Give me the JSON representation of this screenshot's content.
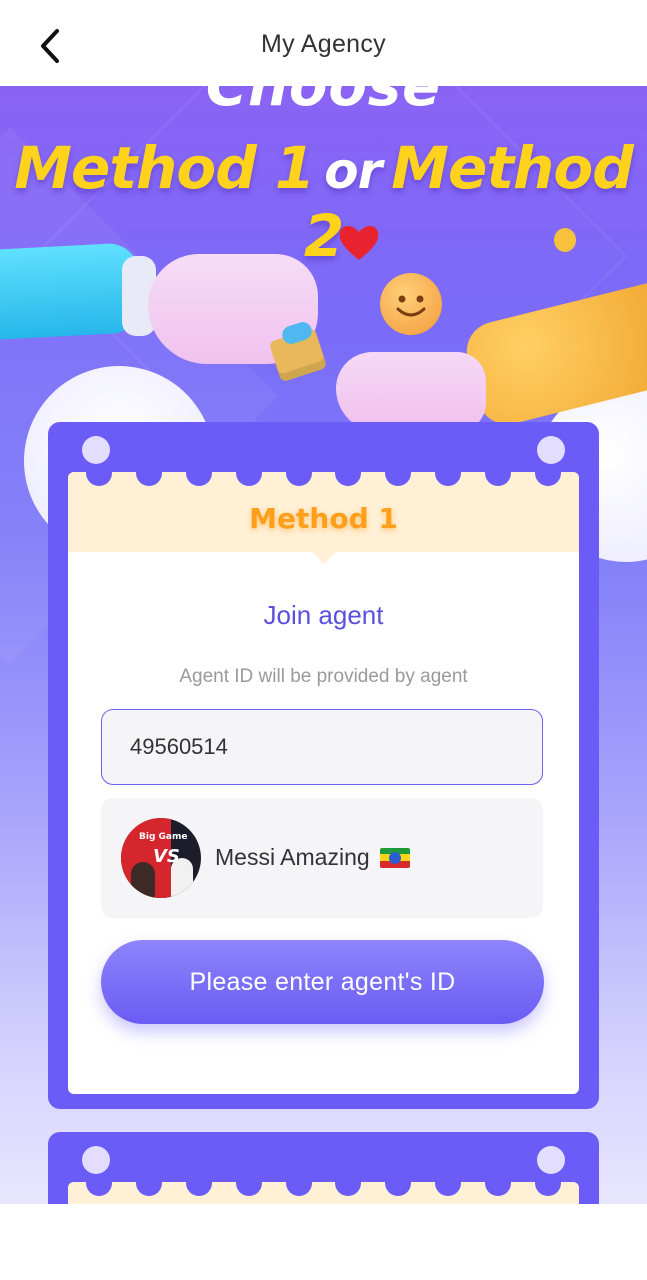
{
  "header": {
    "title": "My Agency",
    "back_icon": "chevron-left-icon"
  },
  "hero": {
    "choose_text": "Choose",
    "method1": "Method 1",
    "or": "or",
    "method2": "Method 2"
  },
  "card1": {
    "method_label": "Method 1",
    "join_title": "Join agent",
    "hint": "Agent ID will be provided by agent",
    "agent_id_value": "49560514",
    "agent": {
      "avatar_caption": "Big Game",
      "avatar_vs": "VS",
      "name": "Messi Amazing",
      "flag": "ethiopia-flag-icon"
    },
    "submit_label": "Please enter agent's ID"
  },
  "colors": {
    "accent": "#6c5cf7",
    "method_yellow": "#ffd21c",
    "method_orange": "#ff9f1c",
    "join_title": "#5b4fe0"
  }
}
